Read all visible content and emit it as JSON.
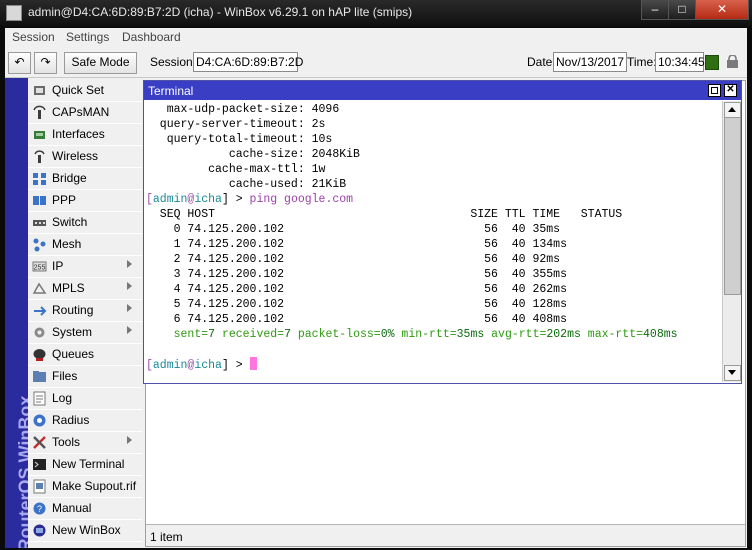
{
  "window": {
    "title": "admin@D4:CA:6D:89:B7:2D (icha) - WinBox v6.29.1 on hAP lite (smips)",
    "buttons": {
      "minimize": "–",
      "maximize": "□",
      "close": "✕"
    }
  },
  "menu": {
    "session": "Session",
    "settings": "Settings",
    "dashboard": "Dashboard"
  },
  "toolbar": {
    "undo": "↶",
    "redo": "↷",
    "safe_mode": "Safe Mode",
    "session_label": "Session:",
    "session_value": "D4:CA:6D:89:B7:2D",
    "date_label": "Date:",
    "date_value": "Nov/13/2017",
    "time_label": "Time:",
    "time_value": "10:34:45"
  },
  "brand": {
    "text": "RouterOS WinBox"
  },
  "sidebar": {
    "items": [
      {
        "label": "Quick Set",
        "icon": "quick-set-icon"
      },
      {
        "label": "CAPsMAN",
        "icon": "capsman-icon"
      },
      {
        "label": "Interfaces",
        "icon": "interfaces-icon"
      },
      {
        "label": "Wireless",
        "icon": "wireless-icon"
      },
      {
        "label": "Bridge",
        "icon": "bridge-icon"
      },
      {
        "label": "PPP",
        "icon": "ppp-icon"
      },
      {
        "label": "Switch",
        "icon": "switch-icon"
      },
      {
        "label": "Mesh",
        "icon": "mesh-icon"
      },
      {
        "label": "IP",
        "icon": "ip-icon",
        "submenu": true
      },
      {
        "label": "MPLS",
        "icon": "mpls-icon",
        "submenu": true
      },
      {
        "label": "Routing",
        "icon": "routing-icon",
        "submenu": true
      },
      {
        "label": "System",
        "icon": "system-icon",
        "submenu": true
      },
      {
        "label": "Queues",
        "icon": "queues-icon"
      },
      {
        "label": "Files",
        "icon": "files-icon"
      },
      {
        "label": "Log",
        "icon": "log-icon"
      },
      {
        "label": "Radius",
        "icon": "radius-icon"
      },
      {
        "label": "Tools",
        "icon": "tools-icon",
        "submenu": true
      },
      {
        "label": "New Terminal",
        "icon": "terminal-icon"
      },
      {
        "label": "Make Supout.rif",
        "icon": "supout-icon"
      },
      {
        "label": "Manual",
        "icon": "manual-icon"
      },
      {
        "label": "New WinBox",
        "icon": "winbox-icon"
      }
    ]
  },
  "main_panel": {
    "footer": "1 item"
  },
  "terminal": {
    "title": "Terminal",
    "config_lines": [
      "   max-udp-packet-size: 4096",
      "  query-server-timeout: 2s",
      "   query-total-timeout: 10s",
      "            cache-size: 2048KiB",
      "         cache-max-ttl: 1w",
      "            cache-used: 21KiB"
    ],
    "prompt": {
      "user": "admin",
      "at": "@",
      "host": "icha",
      "suffix": "] > "
    },
    "command": "ping google.com",
    "table_header": "  SEQ HOST                                     SIZE TTL TIME   STATUS",
    "ping_rows": [
      "    0 74.125.200.102                             56  40 35ms",
      "    1 74.125.200.102                             56  40 134ms",
      "    2 74.125.200.102                             56  40 92ms",
      "    3 74.125.200.102                             56  40 355ms",
      "    4 74.125.200.102                             56  40 262ms",
      "    5 74.125.200.102                             56  40 128ms",
      "    6 74.125.200.102                             56  40 408ms"
    ],
    "summary": [
      {
        "key": "sent",
        "value": "7"
      },
      {
        "key": "received",
        "value": "7"
      },
      {
        "key": "packet-loss",
        "value": "0%"
      },
      {
        "key": "min-rtt",
        "value": "35ms"
      },
      {
        "key": "avg-rtt",
        "value": "202ms"
      },
      {
        "key": "max-rtt",
        "value": "408ms"
      }
    ]
  },
  "colors": {
    "terminal_title_bg": "#3a3ec4",
    "prompt_bracket": "#9b4fa8",
    "prompt_user": "#1a8a9a",
    "command": "#9b3fa8",
    "summary_key": "#2e9b12",
    "summary_value": "#0b6b0b",
    "cursor": "#ff77dd"
  }
}
